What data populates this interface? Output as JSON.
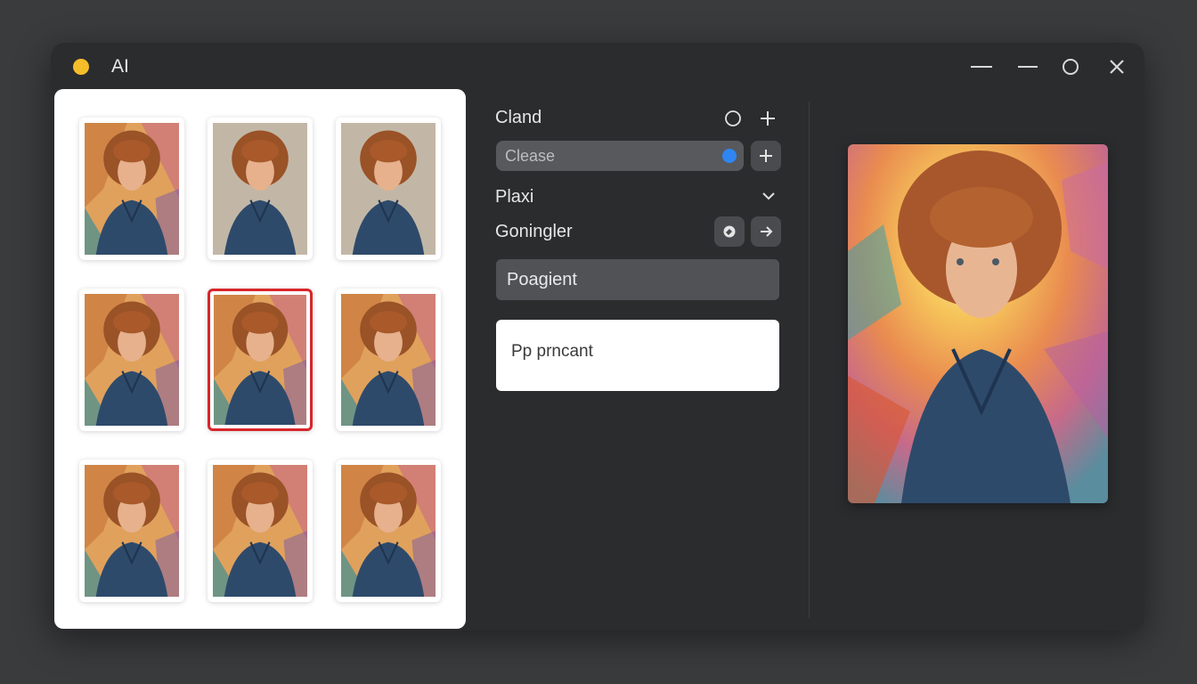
{
  "window": {
    "title": "AI",
    "controls": [
      "minimize-icon",
      "minimize-icon",
      "maximize-icon",
      "close-icon"
    ]
  },
  "colors": {
    "accent_dot": "#f6bd2a",
    "selection_border": "#d8262a",
    "check_blue": "#2f86f1",
    "window_bg": "#2b2c2e"
  },
  "gallery": {
    "thumbnails": [
      {
        "style": "abstract"
      },
      {
        "style": "plain"
      },
      {
        "style": "plain"
      },
      {
        "style": "abstract"
      },
      {
        "style": "abstract",
        "selected": true
      },
      {
        "style": "abstract"
      },
      {
        "style": "abstract"
      },
      {
        "style": "abstract"
      },
      {
        "style": "abstract"
      }
    ]
  },
  "controls": {
    "row1_label": "Cland",
    "select_value": "Clease",
    "row3_label": "Plaxi",
    "row4_label": "Goningler",
    "button_label": "Poagient",
    "prompt_text": "Pp prncant"
  }
}
